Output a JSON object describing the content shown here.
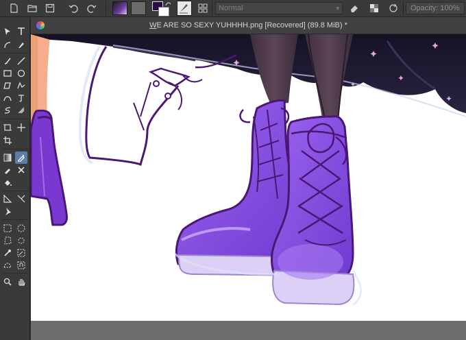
{
  "toolbar": {
    "buttons": [
      "new-document",
      "open-document",
      "save-document",
      "undo",
      "redo"
    ],
    "blending_mode": "Normal",
    "opacity_label": "Opacity: 100%",
    "colors": {
      "foreground": "#2b0a4a",
      "background": "#ffffff"
    }
  },
  "document": {
    "title_underlined": "W",
    "title_rest": "E ARE SO SEXY YUHHHH.png [Recovered]  (89.8 MiB) *"
  },
  "artwork": {
    "description_colors": {
      "boot": "#8a4fe0",
      "boot_outline": "#4a1775",
      "sole": "#ddd0f6",
      "skirt": "#1f1a33",
      "legs": "#4f3c4e",
      "skin": "#f5a98a"
    }
  }
}
